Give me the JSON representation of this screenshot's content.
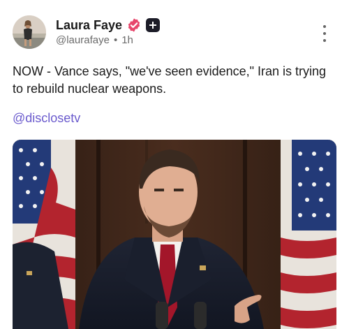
{
  "post": {
    "author_name": "Laura Faye",
    "handle": "@laurafaye",
    "separator": "•",
    "time": "1h",
    "text": "NOW - Vance says, \"we've seen evidence,\" Iran is trying to rebuild nuclear weapons.",
    "mention": "@disclosetv"
  },
  "icons": {
    "verified": "verified-badge-icon",
    "plus": "plus-badge-icon",
    "menu": "more-options-icon"
  },
  "colors": {
    "verified_badge": "#e7466b",
    "mention": "#6a5acd",
    "plus_badge": "#1c1c28"
  }
}
